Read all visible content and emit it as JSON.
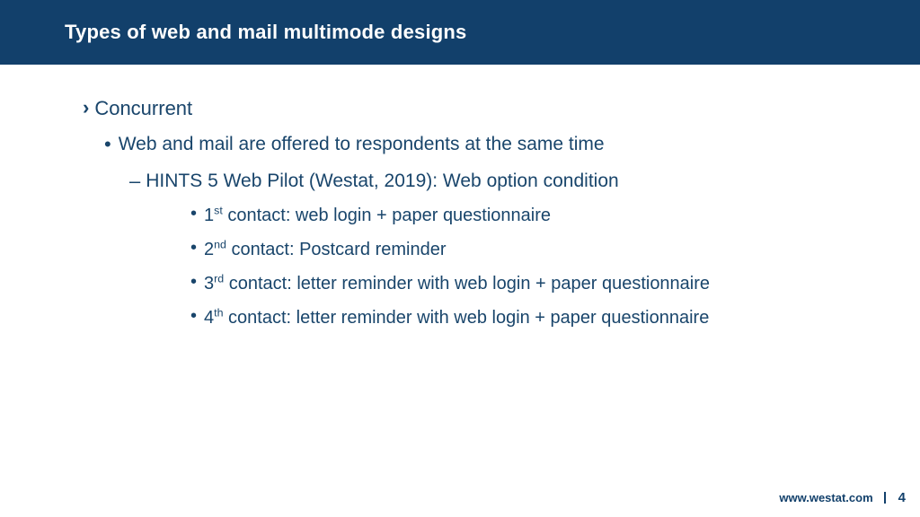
{
  "title": "Types of web and mail multimode designs",
  "lvl1": "Concurrent",
  "lvl2": "Web and mail are offered to respondents at the same time",
  "lvl3": "HINTS 5 Web Pilot (Westat, 2019): Web option condition",
  "contacts": [
    {
      "ord_num": "1",
      "ord_suf": "st",
      "rest": " contact: web login + paper questionnaire"
    },
    {
      "ord_num": "2",
      "ord_suf": "nd",
      "rest": " contact: Postcard reminder"
    },
    {
      "ord_num": "3",
      "ord_suf": "rd",
      "rest": " contact: letter reminder with web login + paper questionnaire"
    },
    {
      "ord_num": "4",
      "ord_suf": "th",
      "rest": " contact: letter reminder with web login + paper questionnaire"
    }
  ],
  "footer": {
    "url": "www.westat.com",
    "page": "4"
  }
}
